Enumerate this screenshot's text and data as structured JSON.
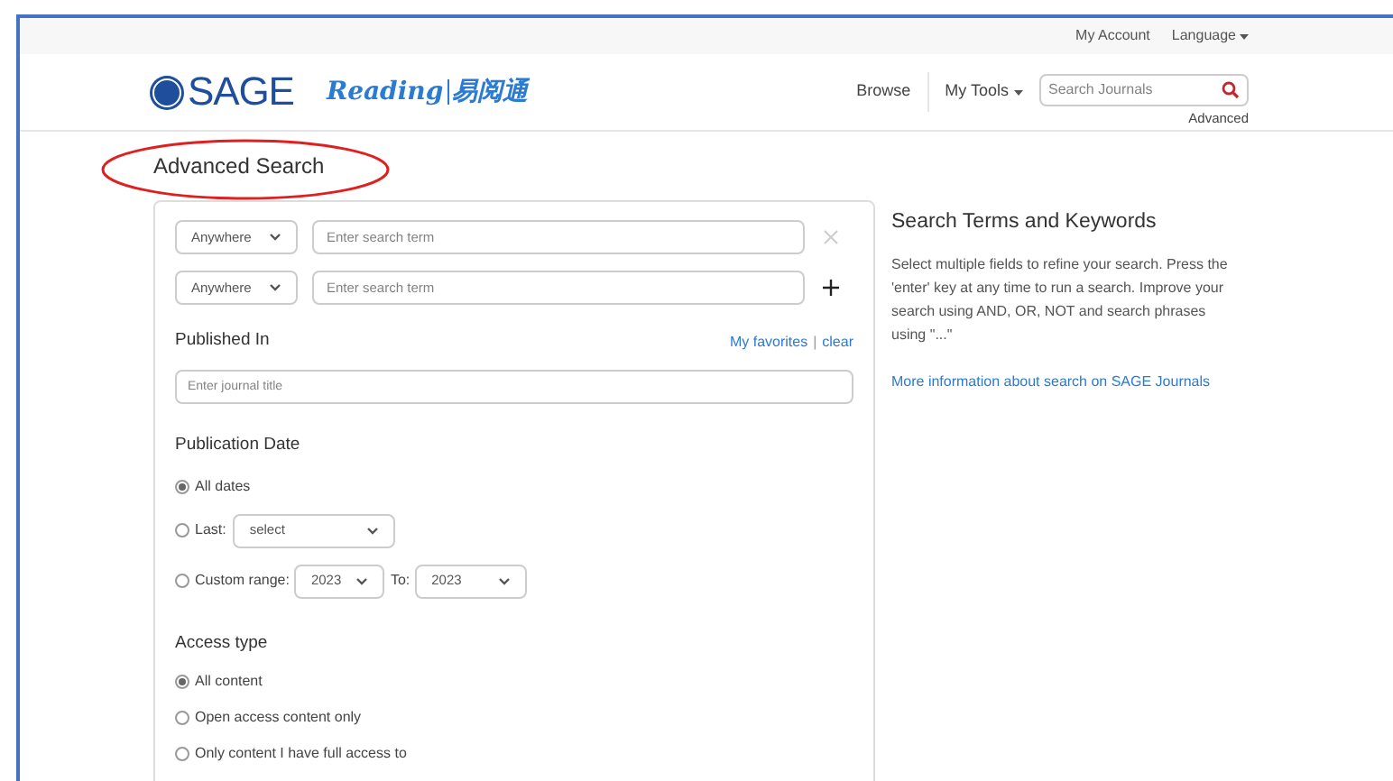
{
  "top_bar": {
    "links": [
      {
        "label": "My Account",
        "kind": "link"
      },
      {
        "label": "Language",
        "kind": "dropdown"
      }
    ]
  },
  "header": {
    "logo": "SAGE",
    "partner_logo": {
      "latin": "Reading",
      "chinese": "易阅通"
    },
    "nav": [
      {
        "label": "Browse",
        "kind": "link"
      },
      {
        "label": "My Tools",
        "kind": "dropdown"
      }
    ],
    "search": {
      "placeholder": "Search Journals"
    },
    "advanced_link": "Advanced"
  },
  "page_title": "Advanced Search",
  "form": {
    "term_rows": [
      {
        "field": "Anywhere",
        "placeholder": "Enter search term",
        "kind": "remove"
      },
      {
        "field": "Anywhere",
        "placeholder": "Enter search term",
        "kind": "add"
      }
    ],
    "published_in": {
      "heading": "Published In",
      "favorites": "My favorites",
      "separator": "|",
      "clear": "clear",
      "placeholder": "Enter journal title"
    },
    "publication_date": {
      "heading": "Publication Date",
      "options": [
        {
          "label": "All dates",
          "kind": "plain",
          "selected": true
        },
        {
          "label": "Last:",
          "kind": "last",
          "selected": false,
          "value": "select"
        },
        {
          "label": "Custom range:",
          "kind": "range",
          "selected": false,
          "from": "2023",
          "to_label": "To:",
          "to": "2023"
        }
      ]
    },
    "access_type": {
      "heading": "Access type",
      "options": [
        {
          "label": "All content",
          "selected": true
        },
        {
          "label": "Open access content only",
          "selected": false
        },
        {
          "label": "Only content I have full access to",
          "selected": false
        }
      ]
    }
  },
  "help": {
    "heading": "Search Terms and Keywords",
    "text": "Select multiple fields to refine your search. Press the 'enter' key at any time to run a search. Improve your search using AND, OR, NOT and search phrases using \"...\"",
    "link": "More information about search on SAGE Journals"
  }
}
